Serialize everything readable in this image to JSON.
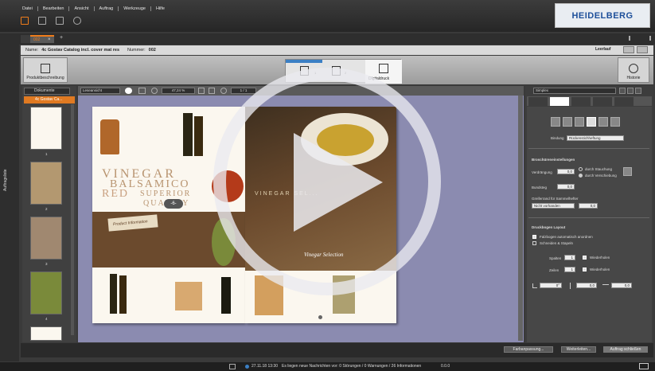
{
  "menu": [
    "Datei",
    "Bearbeiten",
    "Ansicht",
    "Auftrag",
    "Werkzeuge",
    "Hilfe"
  ],
  "logo_text": "HEIDELBERG",
  "tabs": {
    "active": "002",
    "add": "+",
    "close": "×"
  },
  "job": {
    "name_label": "Name:",
    "name_value": "4c Gostav Catalog incl. cover mat res",
    "number_label": "Nummer:",
    "number_value": "002"
  },
  "leerlauf": "Leerlauf",
  "workflow": {
    "left_label": "Produktbeschreibung",
    "step_label": "Digitaldruck",
    "right_label": "Historie",
    "step_num_1": "1",
    "step_num_2": "2",
    "step_num_3": "3"
  },
  "sidebar_vertical": "Auftragsliste",
  "doc_panel": {
    "dropdown": "Dokumente",
    "item": "4c Gostav Ca...",
    "page_numbers": [
      "1",
      "2",
      "3",
      "4"
    ]
  },
  "view_toolbar": {
    "mode": "Leseansicht",
    "zoom": "47,24 %",
    "page": "1 / 1"
  },
  "page_text": {
    "vinegar": "VINEGAR",
    "balsamico": "BALSAMICO",
    "red": "RED",
    "superior": "SUPERIOR",
    "quality": "QUALITY",
    "page_marker": "-6-",
    "banner": "Product Information",
    "sel_title": "VINEGAR SEL...",
    "script": "Vinegar Selection"
  },
  "right_panel": {
    "preset": "Simplex",
    "bindung_label": "Bindung",
    "bindung_value": "Rückenstichheftung",
    "broschur_title": "Broschüreneinstellungen",
    "verdraengung_label": "Verdrängung",
    "verdraengung_value": "0,0",
    "radio1": "durch Stauchung",
    "radio2": "durch Verschiebung",
    "bundsteg_label": "Bundsteg",
    "bundsteg_value": "0,0",
    "greifer_label": "Greiferrand für Sammelhefter",
    "greifer_select": "Nicht vorhanden",
    "greifer_value": "0,0",
    "druckbogen_title": "Druckbogen Layout",
    "check1": "Falzbogen automatisch anordnen",
    "check2": "Schneiden & Stapeln",
    "spalten_label": "Spalten",
    "spalten_value": "1",
    "wiederholen1": "Wiederholen",
    "zeilen_label": "Zeilen",
    "zeilen_value": "1",
    "wiederholen2": "Wiederholen",
    "angle_value": "0°",
    "v1": "0,0",
    "v2": "0,0"
  },
  "bottom_buttons": {
    "farb": "Farbanpassung...",
    "weiter": "Weiterleiten...",
    "schliessen": "Auftrag schließen"
  },
  "status": {
    "time": "27.11.18 13:30",
    "message": "Es liegen neue Nachrichten vor: 0 Störungen / 0 Warnungen / 26 Informationen",
    "version": "0.0.0"
  },
  "colors": {
    "accent": "#f07c1a",
    "heidelberg_blue": "#1d4f9a",
    "canvas_bg": "#8b8bb0",
    "brown": "#6b4a2d"
  }
}
